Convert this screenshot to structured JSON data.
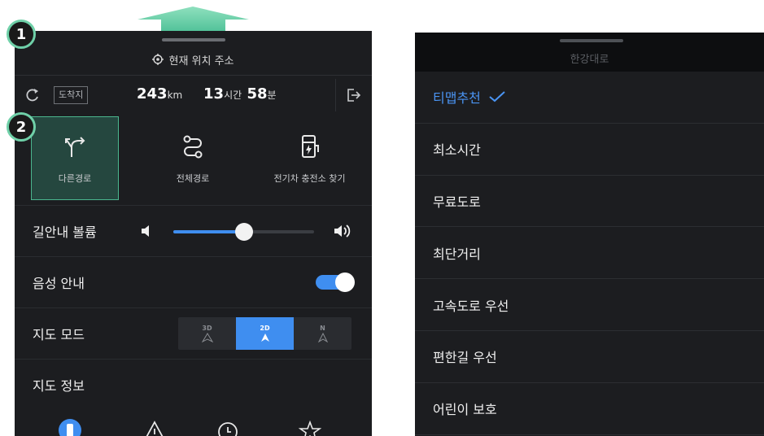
{
  "left_panel": {
    "current_location_label": "현재 위치 주소",
    "trip": {
      "destination_badge": "도착지",
      "distance_value": "243",
      "distance_unit": "km",
      "hours_value": "13",
      "hours_unit": "시간",
      "minutes_value": "58",
      "minutes_unit": "분"
    },
    "quick_actions": [
      {
        "label": "다른경로",
        "icon": "alternate-route-icon",
        "selected": true
      },
      {
        "label": "전체경로",
        "icon": "full-route-icon",
        "selected": false
      },
      {
        "label": "전기차 충전소 찾기",
        "icon": "ev-charging-station-icon",
        "selected": false
      }
    ],
    "settings": {
      "volume_label": "길안내 볼륨",
      "volume_level": 0.5,
      "voice_label": "음성 안내",
      "voice_enabled": true,
      "map_mode_label": "지도 모드",
      "map_modes": [
        {
          "label": "3D",
          "active": false
        },
        {
          "label": "2D",
          "active": true
        },
        {
          "label": "N",
          "active": false
        }
      ],
      "map_info_label": "지도 정보",
      "map_info_icons": [
        "traffic-light-icon",
        "warning-icon",
        "clock-icon",
        "star-icon"
      ]
    }
  },
  "callouts": [
    "1",
    "2"
  ],
  "right_panel": {
    "title": "한강대로",
    "options": [
      {
        "label": "티맵추천",
        "selected": true
      },
      {
        "label": "최소시간",
        "selected": false
      },
      {
        "label": "무료도로",
        "selected": false
      },
      {
        "label": "최단거리",
        "selected": false
      },
      {
        "label": "고속도로 우선",
        "selected": false
      },
      {
        "label": "편한길 우선",
        "selected": false
      },
      {
        "label": "어린이 보호",
        "selected": false
      }
    ]
  },
  "colors": {
    "panel_bg": "#1c1d20",
    "accent_blue": "#3f8ef0",
    "selected_green": "#25473f",
    "callout_ring": "#6fd0a8"
  }
}
